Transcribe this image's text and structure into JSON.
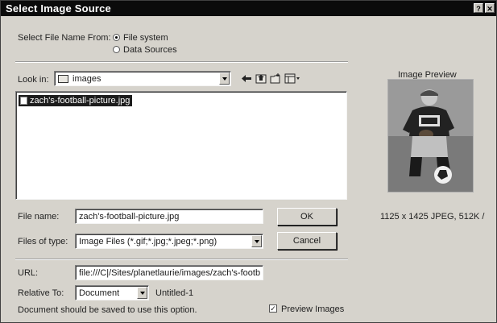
{
  "window": {
    "title": "Select Image Source"
  },
  "source": {
    "label": "Select File Name From:",
    "options": [
      "File system",
      "Data Sources"
    ],
    "selected": "File system"
  },
  "look_in": {
    "label": "Look in:",
    "value": "images"
  },
  "file_list": {
    "items": [
      "zach's-football-picture.jpg"
    ],
    "selected": "zach's-football-picture.jpg"
  },
  "file_name": {
    "label": "File name:",
    "value": "zach's-football-picture.jpg"
  },
  "files_of_type": {
    "label": "Files of type:",
    "value": "Image Files (*.gif;*.jpg;*.jpeg;*.png)"
  },
  "buttons": {
    "ok": "OK",
    "cancel": "Cancel"
  },
  "url": {
    "label": "URL:",
    "value": "file:///C|/Sites/planetlaurie/images/zach's-footb"
  },
  "relative_to": {
    "label": "Relative To:",
    "value": "Document",
    "document_name": "Untitled-1"
  },
  "notice": "Document should be saved to use this option.",
  "preview_images": {
    "label": "Preview Images",
    "checked": true
  },
  "preview": {
    "label": "Image Preview",
    "info": "1125 x 1425 JPEG, 512K /"
  },
  "colors": {
    "titlebar": "#0b0b0b",
    "dialog": "#d6d3cc",
    "selection": "#1c1c1c"
  }
}
